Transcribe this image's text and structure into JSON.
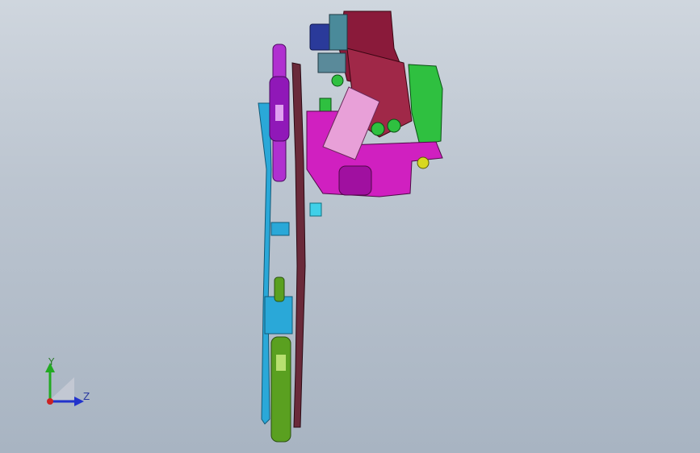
{
  "viewport": {
    "background_top": "#cfd6de",
    "background_bottom": "#a8b4c2"
  },
  "triad": {
    "y_label": "Y",
    "z_label": "Z",
    "y_color": "#22aa22",
    "z_color": "#2233cc",
    "origin_color": "#cc2222"
  },
  "model": {
    "colors": {
      "pulley_purple": "#b030d0",
      "body_maroon": "#8a1a3a",
      "link_magenta": "#d020c0",
      "mount_green": "#2fc040",
      "cage_cyan": "#2aa8d8",
      "cage_maroon": "#6a2a3a",
      "pulley_green": "#5aa020",
      "knob_blue": "#2a3a9a",
      "arm_pink": "#e8a0d8",
      "accent_yellow": "#d8d820"
    }
  }
}
